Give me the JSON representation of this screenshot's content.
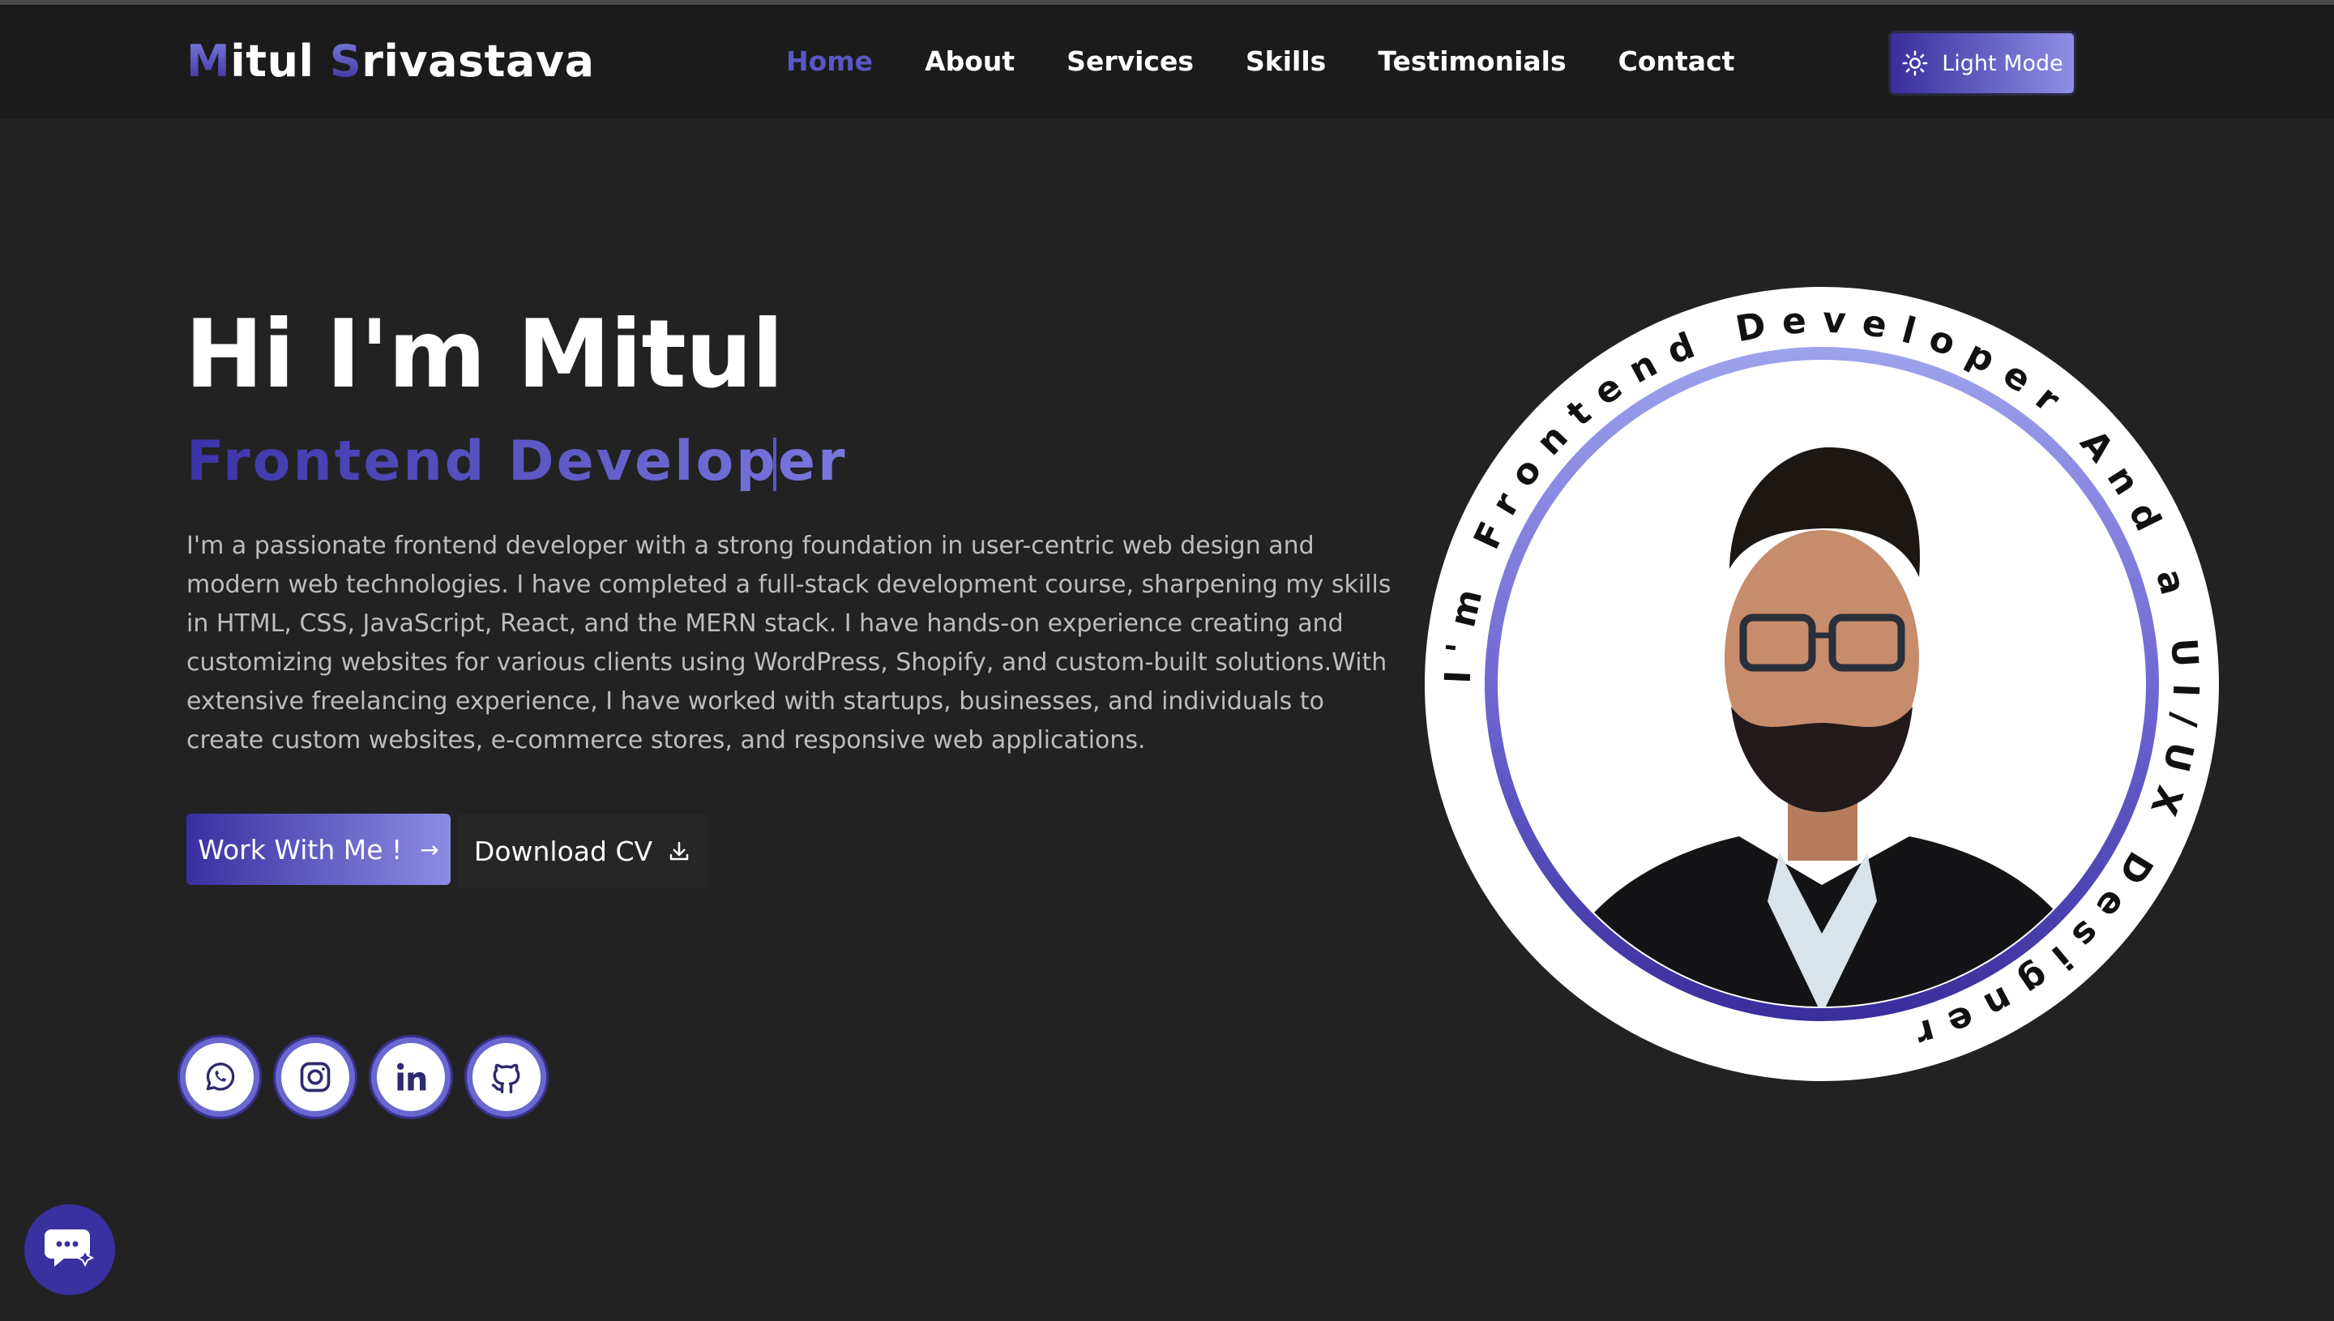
{
  "header": {
    "brand_first_initial": "M",
    "brand_first_rest": "itul ",
    "brand_last_initial": "S",
    "brand_last_rest": "rivastava",
    "nav": [
      {
        "label": "Home",
        "active": true
      },
      {
        "label": "About",
        "active": false
      },
      {
        "label": "Services",
        "active": false
      },
      {
        "label": "Skills",
        "active": false
      },
      {
        "label": "Testimonials",
        "active": false
      },
      {
        "label": "Contact",
        "active": false
      }
    ],
    "mode_toggle_label": "Light Mode",
    "mode_toggle_icon": "sun-icon"
  },
  "hero": {
    "title": "Hi I'm Mitul",
    "subtitle": "Frontend Developer",
    "description": "I'm a passionate frontend developer with a strong foundation in user-centric web design and modern web technologies. I have completed a full-stack development course, sharpening my skills in HTML, CSS, JavaScript, React, and the MERN stack. I have hands-on experience creating and customizing websites for various clients using WordPress, Shopify, and custom-built solutions.With extensive freelancing experience, I have worked with startups, businesses, and individuals to create custom websites, e-commerce stores, and responsive web applications.",
    "primary_button": "Work With Me !",
    "primary_button_icon": "arrow-right-icon",
    "secondary_button": "Download CV",
    "secondary_button_icon": "download-icon",
    "circle_text": "I'm Frontend Developer And a UI/UX Designer"
  },
  "socials": [
    {
      "icon": "whatsapp-icon"
    },
    {
      "icon": "instagram-icon"
    },
    {
      "icon": "linkedin-icon"
    },
    {
      "icon": "github-icon"
    }
  ],
  "chat_widget_icon": "chat-icon",
  "colors": {
    "background": "#222223",
    "navbar": "#1b1b1c",
    "accent_dark": "#3b2fa0",
    "accent_light": "#8b8ce4",
    "text": "#ffffff",
    "muted_text": "#bdbdbd"
  }
}
